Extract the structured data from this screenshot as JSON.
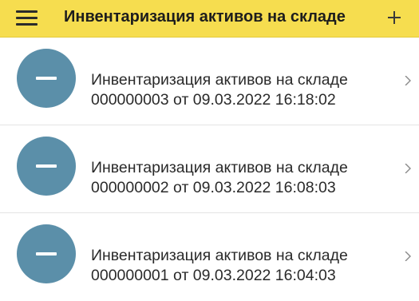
{
  "header": {
    "title": "Инвентаризация активов на складе",
    "menu_icon": "hamburger-menu-icon",
    "add_icon": "plus-icon",
    "background": "#f6dd4f"
  },
  "documents": [
    {
      "title": "Инвентаризация активов на складе",
      "subtitle": "000000003 от 09.03.2022 16:18:02",
      "icon": "minus-circle-icon"
    },
    {
      "title": "Инвентаризация активов на складе",
      "subtitle": "000000002 от 09.03.2022 16:08:03",
      "icon": "minus-circle-icon"
    },
    {
      "title": "Инвентаризация активов на складе",
      "subtitle": "000000001 от 09.03.2022 16:04:03",
      "icon": "minus-circle-icon"
    }
  ],
  "colors": {
    "avatar": "#5b8fa9",
    "divider": "#e4e4e4"
  }
}
